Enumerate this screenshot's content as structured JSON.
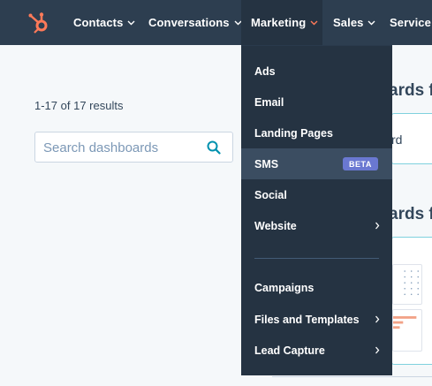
{
  "nav": {
    "items": [
      {
        "label": "Contacts"
      },
      {
        "label": "Conversations"
      },
      {
        "label": "Marketing"
      },
      {
        "label": "Sales"
      },
      {
        "label": "Service"
      }
    ],
    "accent": "#ff7a59",
    "background": "#2d3e50"
  },
  "main": {
    "results_text": "1-17 of 17 results",
    "search": {
      "placeholder": "Search dashboards",
      "value": ""
    },
    "partial_heading_1": "ards f",
    "partial_card_text": "rd",
    "partial_heading_2": "ards f"
  },
  "marketing_menu": {
    "items": [
      {
        "label": "Ads"
      },
      {
        "label": "Email"
      },
      {
        "label": "Landing Pages"
      },
      {
        "label": "SMS",
        "badge": "BETA"
      },
      {
        "label": "Social"
      },
      {
        "label": "Website"
      },
      {
        "label": "Campaigns"
      },
      {
        "label": "Files and Templates"
      },
      {
        "label": "Lead Capture"
      }
    ],
    "badge_color": "#6a78d1"
  }
}
